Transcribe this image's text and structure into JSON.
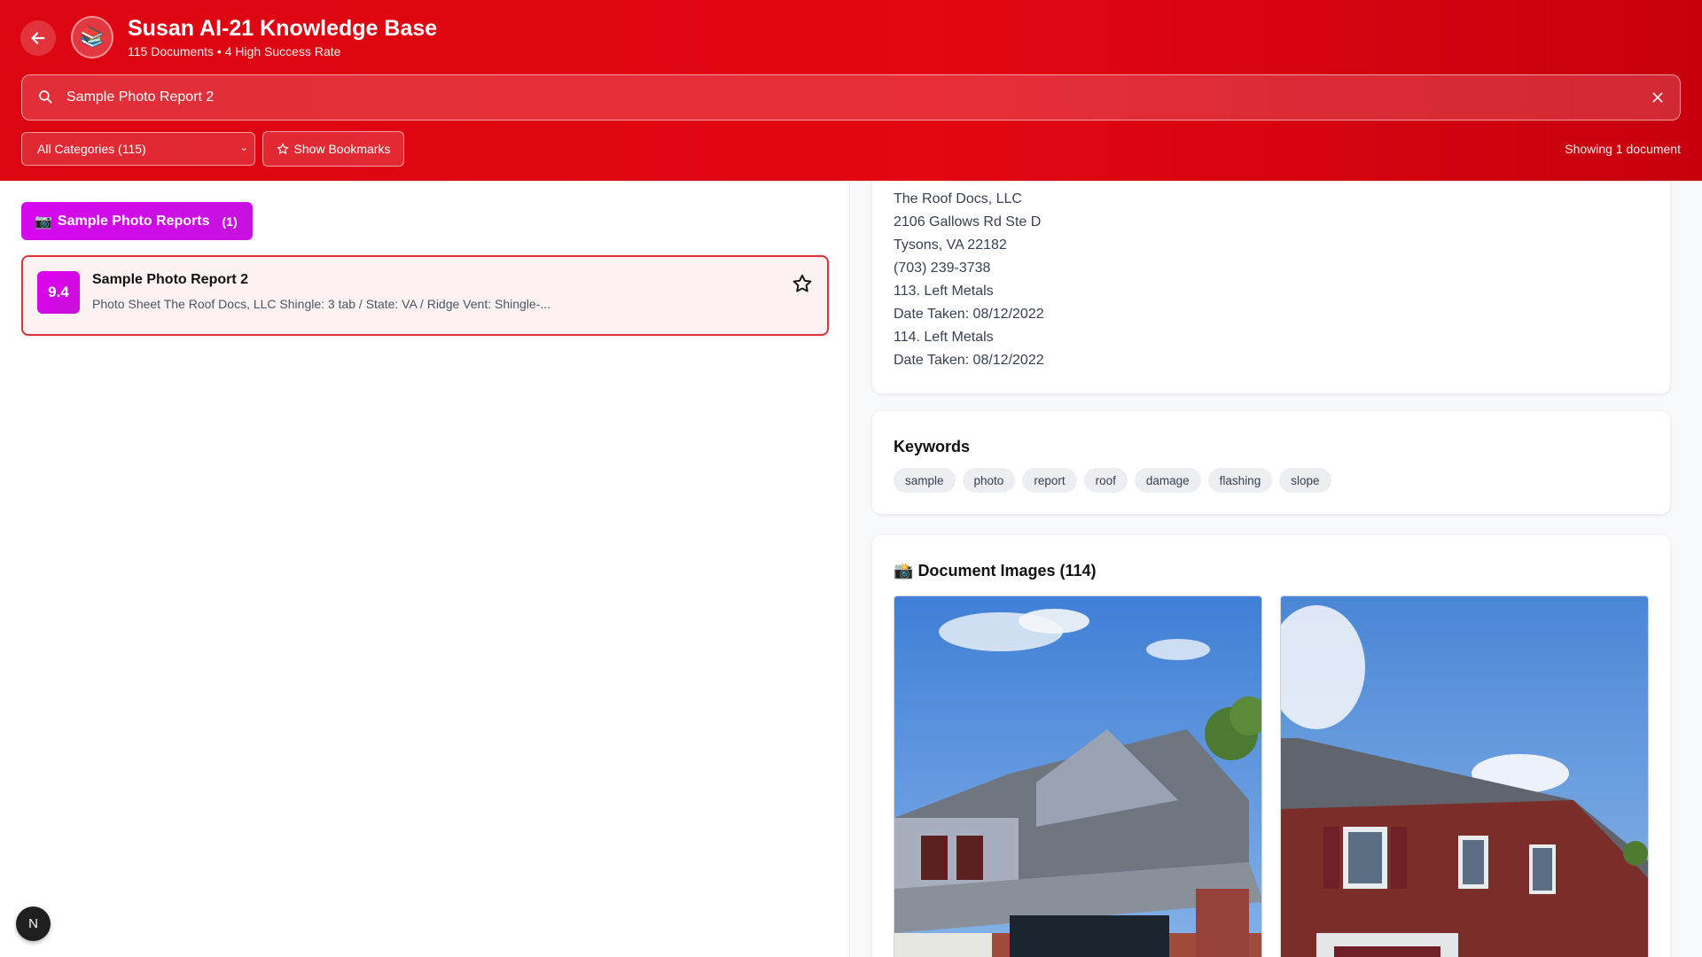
{
  "header": {
    "title": "Susan AI-21 Knowledge Base",
    "subtitle": "115 Documents • 4 High Success Rate",
    "logo_icon": "books-icon",
    "back_icon": "arrow-left-icon"
  },
  "search": {
    "value": "Sample Photo Report 2",
    "clear_icon": "close-icon"
  },
  "filters": {
    "category_selected": "All Categories (115)",
    "bookmarks_label": "Show Bookmarks",
    "showing": "Showing 1 document"
  },
  "results": {
    "category": {
      "emoji": "📷",
      "label": "Sample Photo Reports",
      "count": "(1)"
    },
    "documents": [
      {
        "score": "9.4",
        "title": "Sample Photo Report 2",
        "snippet": "Photo Sheet The Roof Docs, LLC Shingle: 3 tab / State: VA / Ridge Vent: Shingle-..."
      }
    ]
  },
  "detail": {
    "content_lines": [
      "The Roof Docs, LLC",
      "2106 Gallows Rd Ste D",
      "Tysons, VA 22182",
      "(703) 239-3738",
      "113. Left Metals",
      "Date Taken: 08/12/2022",
      "114. Left Metals",
      "Date Taken: 08/12/2022"
    ],
    "keywords_title": "Keywords",
    "keywords": [
      "sample",
      "photo",
      "report",
      "roof",
      "damage",
      "flashing",
      "slope"
    ],
    "images_emoji": "📸",
    "images_title": "Document Images (114)"
  },
  "dev_badge": "N",
  "colors": {
    "brand_red": "#e30613",
    "accent_magenta": "#d607ee",
    "selected_border": "#e0303c"
  }
}
